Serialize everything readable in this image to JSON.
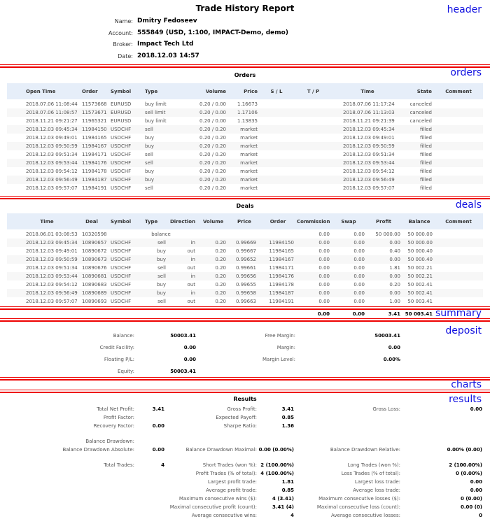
{
  "header": {
    "title": "Trade History Report",
    "fields": [
      {
        "label": "Name:",
        "value": "Dmitry Fedoseev"
      },
      {
        "label": "Account:",
        "value": "555849 (USD, 1:100, IMPACT-Demo, demo)"
      },
      {
        "label": "Broker:",
        "value": "Impact Tech Ltd"
      },
      {
        "label": "Date:",
        "value": "2018.12.03 14:57"
      }
    ]
  },
  "tags": {
    "header": "header",
    "orders": "orders",
    "deals": "deals",
    "summary": "summary",
    "deposit": "deposit",
    "charts": "charts",
    "results": "results"
  },
  "colors": {
    "accent_line": "#e00000",
    "tag": "#1010e0",
    "table_header_bg": "#e6eef9"
  },
  "orders": {
    "title": "Orders",
    "columns": [
      "Open Time",
      "Order",
      "Symbol",
      "Type",
      "Volume",
      "Price",
      "S / L",
      "T / P",
      "Time",
      "State",
      "Comment"
    ],
    "rows": [
      [
        "2018.07.06 11:08:44",
        "11573668",
        "EURUSD",
        "buy limit",
        "0.20 / 0.00",
        "1.16673",
        "",
        "",
        "2018.07.06 11:17:24",
        "canceled",
        ""
      ],
      [
        "2018.07.06 11:08:57",
        "11573671",
        "EURUSD",
        "sell limit",
        "0.20 / 0.00",
        "1.17106",
        "",
        "",
        "2018.07.06 11:13:03",
        "canceled",
        ""
      ],
      [
        "2018.11.21 09:21:27",
        "11965321",
        "EURUSD",
        "buy limit",
        "0.20 / 0.00",
        "1.13835",
        "",
        "",
        "2018.11.21 09:21:39",
        "canceled",
        ""
      ],
      [
        "2018.12.03 09:45:34",
        "11984150",
        "USDCHF",
        "sell",
        "0.20 / 0.20",
        "market",
        "",
        "",
        "2018.12.03 09:45:34",
        "filled",
        ""
      ],
      [
        "2018.12.03 09:49:01",
        "11984165",
        "USDCHF",
        "buy",
        "0.20 / 0.20",
        "market",
        "",
        "",
        "2018.12.03 09:49:01",
        "filled",
        ""
      ],
      [
        "2018.12.03 09:50:59",
        "11984167",
        "USDCHF",
        "buy",
        "0.20 / 0.20",
        "market",
        "",
        "",
        "2018.12.03 09:50:59",
        "filled",
        ""
      ],
      [
        "2018.12.03 09:51:34",
        "11984171",
        "USDCHF",
        "sell",
        "0.20 / 0.20",
        "market",
        "",
        "",
        "2018.12.03 09:51:34",
        "filled",
        ""
      ],
      [
        "2018.12.03 09:53:44",
        "11984176",
        "USDCHF",
        "sell",
        "0.20 / 0.20",
        "market",
        "",
        "",
        "2018.12.03 09:53:44",
        "filled",
        ""
      ],
      [
        "2018.12.03 09:54:12",
        "11984178",
        "USDCHF",
        "buy",
        "0.20 / 0.20",
        "market",
        "",
        "",
        "2018.12.03 09:54:12",
        "filled",
        ""
      ],
      [
        "2018.12.03 09:56:49",
        "11984187",
        "USDCHF",
        "buy",
        "0.20 / 0.20",
        "market",
        "",
        "",
        "2018.12.03 09:56:49",
        "filled",
        ""
      ],
      [
        "2018.12.03 09:57:07",
        "11984191",
        "USDCHF",
        "sell",
        "0.20 / 0.20",
        "market",
        "",
        "",
        "2018.12.03 09:57:07",
        "filled",
        ""
      ]
    ]
  },
  "deals": {
    "title": "Deals",
    "columns": [
      "Time",
      "Deal",
      "Symbol",
      "Type",
      "Direction",
      "Volume",
      "Price",
      "Order",
      "Commission",
      "Swap",
      "Profit",
      "Balance",
      "Comment"
    ],
    "rows": [
      [
        "2018.06.01 03:08:53",
        "10320598",
        "",
        "balance",
        "",
        "",
        "",
        "",
        "0.00",
        "0.00",
        "50 000.00",
        "50 000.00",
        ""
      ],
      [
        "2018.12.03 09:45:34",
        "10890657",
        "USDCHF",
        "sell",
        "in",
        "0.20",
        "0.99669",
        "11984150",
        "0.00",
        "0.00",
        "0.00",
        "50 000.00",
        ""
      ],
      [
        "2018.12.03 09:49:01",
        "10890672",
        "USDCHF",
        "buy",
        "out",
        "0.20",
        "0.99667",
        "11984165",
        "0.00",
        "0.00",
        "0.40",
        "50 000.40",
        ""
      ],
      [
        "2018.12.03 09:50:59",
        "10890673",
        "USDCHF",
        "buy",
        "in",
        "0.20",
        "0.99652",
        "11984167",
        "0.00",
        "0.00",
        "0.00",
        "50 000.40",
        ""
      ],
      [
        "2018.12.03 09:51:34",
        "10890676",
        "USDCHF",
        "sell",
        "out",
        "0.20",
        "0.99661",
        "11984171",
        "0.00",
        "0.00",
        "1.81",
        "50 002.21",
        ""
      ],
      [
        "2018.12.03 09:53:44",
        "10890681",
        "USDCHF",
        "sell",
        "in",
        "0.20",
        "0.99656",
        "11984176",
        "0.00",
        "0.00",
        "0.00",
        "50 002.21",
        ""
      ],
      [
        "2018.12.03 09:54:12",
        "10890683",
        "USDCHF",
        "buy",
        "out",
        "0.20",
        "0.99655",
        "11984178",
        "0.00",
        "0.00",
        "0.20",
        "50 002.41",
        ""
      ],
      [
        "2018.12.03 09:56:49",
        "10890689",
        "USDCHF",
        "buy",
        "in",
        "0.20",
        "0.99658",
        "11984187",
        "0.00",
        "0.00",
        "0.00",
        "50 002.41",
        ""
      ],
      [
        "2018.12.03 09:57:07",
        "10890693",
        "USDCHF",
        "sell",
        "out",
        "0.20",
        "0.99663",
        "11984191",
        "0.00",
        "0.00",
        "1.00",
        "50 003.41",
        ""
      ]
    ],
    "summary": {
      "commission": "0.00",
      "swap": "0.00",
      "profit": "3.41",
      "balance": "50 003.41"
    }
  },
  "deposit": {
    "left": [
      {
        "label": "Balance:",
        "value": "50003.41"
      },
      {
        "label": "Credit Facility:",
        "value": "0.00"
      },
      {
        "label": "Floating P/L:",
        "value": "0.00"
      },
      {
        "label": "Equity:",
        "value": "50003.41"
      }
    ],
    "right": [
      {
        "label": "Free Margin:",
        "value": "50003.41"
      },
      {
        "label": "Margin:",
        "value": "0.00"
      },
      {
        "label": "Margin Level:",
        "value": "0.00%"
      }
    ]
  },
  "results": {
    "title": "Results",
    "rows": [
      [
        [
          "Total Net Profit:",
          "3.41"
        ],
        [
          "Gross Profit:",
          "3.41"
        ],
        [
          "Gross Loss:",
          "0.00"
        ]
      ],
      [
        [
          "Profit Factor:",
          ""
        ],
        [
          "Expected Payoff:",
          "0.85"
        ],
        [
          "",
          ""
        ]
      ],
      [
        [
          "Recovery Factor:",
          "0.00"
        ],
        [
          "Sharpe Ratio:",
          "1.36"
        ],
        [
          "",
          ""
        ]
      ],
      null,
      [
        [
          "Balance Drawdown:",
          ""
        ],
        [
          "",
          ""
        ],
        [
          "",
          ""
        ]
      ],
      [
        [
          "Balance Drawdown Absolute:",
          "0.00"
        ],
        [
          "Balance Drawdown Maximal:",
          "0.00 (0.00%)"
        ],
        [
          "Balance Drawdown Relative:",
          "0.00% (0.00)"
        ]
      ],
      null,
      [
        [
          "Total Trades:",
          "4"
        ],
        [
          "Short Trades (won %):",
          "2 (100.00%)"
        ],
        [
          "Long Trades (won %):",
          "2 (100.00%)"
        ]
      ],
      [
        [
          "",
          ""
        ],
        [
          "Profit Trades (% of total):",
          "4 (100.00%)"
        ],
        [
          "Loss Trades (% of total):",
          "0 (0.00%)"
        ]
      ],
      [
        [
          "",
          ""
        ],
        [
          "Largest profit trade:",
          "1.81"
        ],
        [
          "Largest loss trade:",
          "0.00"
        ]
      ],
      [
        [
          "",
          ""
        ],
        [
          "Average profit trade:",
          "0.85"
        ],
        [
          "Average loss trade:",
          "0.00"
        ]
      ],
      [
        [
          "",
          ""
        ],
        [
          "Maximum consecutive wins ($):",
          "4 (3.41)"
        ],
        [
          "Maximum consecutive losses ($):",
          "0 (0.00)"
        ]
      ],
      [
        [
          "",
          ""
        ],
        [
          "Maximal consecutive profit (count):",
          "3.41 (4)"
        ],
        [
          "Maximal consecutive loss (count):",
          "0.00 (0)"
        ]
      ],
      [
        [
          "",
          ""
        ],
        [
          "Average consecutive wins:",
          "4"
        ],
        [
          "Average consecutive losses:",
          "0"
        ]
      ]
    ]
  }
}
